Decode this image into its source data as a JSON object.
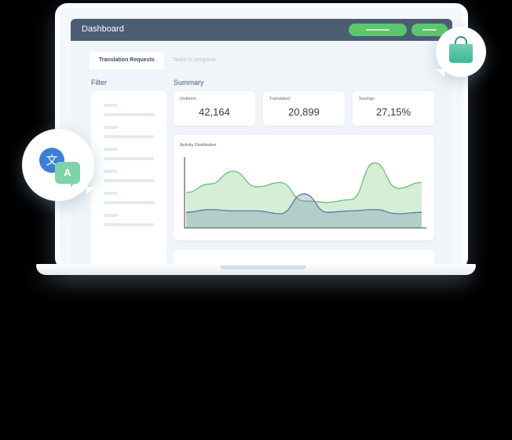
{
  "header": {
    "title": "Dashboard"
  },
  "tabs": [
    {
      "label": "Translation Requests",
      "active": true
    },
    {
      "label": "Tasks in progress",
      "active": false
    }
  ],
  "filter": {
    "title": "Filter"
  },
  "summary": {
    "title": "Summary",
    "cards": [
      {
        "label": "Ordered",
        "value": "42,164"
      },
      {
        "label": "Translated",
        "value": "20,899"
      },
      {
        "label": "Savings",
        "value": "27,15%"
      }
    ]
  },
  "chart_data": {
    "type": "area",
    "title": "Activity Distribution",
    "xlabel": "",
    "ylabel": "",
    "grid": false,
    "series": [
      {
        "color": "#6cc070",
        "values": [
          50,
          62,
          80,
          58,
          64,
          38,
          36,
          40,
          92,
          56,
          64
        ]
      },
      {
        "color": "#5b79a6",
        "values": [
          22,
          26,
          24,
          24,
          20,
          48,
          22,
          24,
          26,
          20,
          22
        ]
      }
    ]
  },
  "icons": {
    "translate_primary": "文",
    "translate_secondary": "A"
  },
  "colors": {
    "topbar": "#4a5d72",
    "accent_green": "#5cc76a",
    "translate_blue": "#3d7fd6",
    "translate_mint": "#7ed3a8",
    "bag_green": "#3fb595"
  }
}
